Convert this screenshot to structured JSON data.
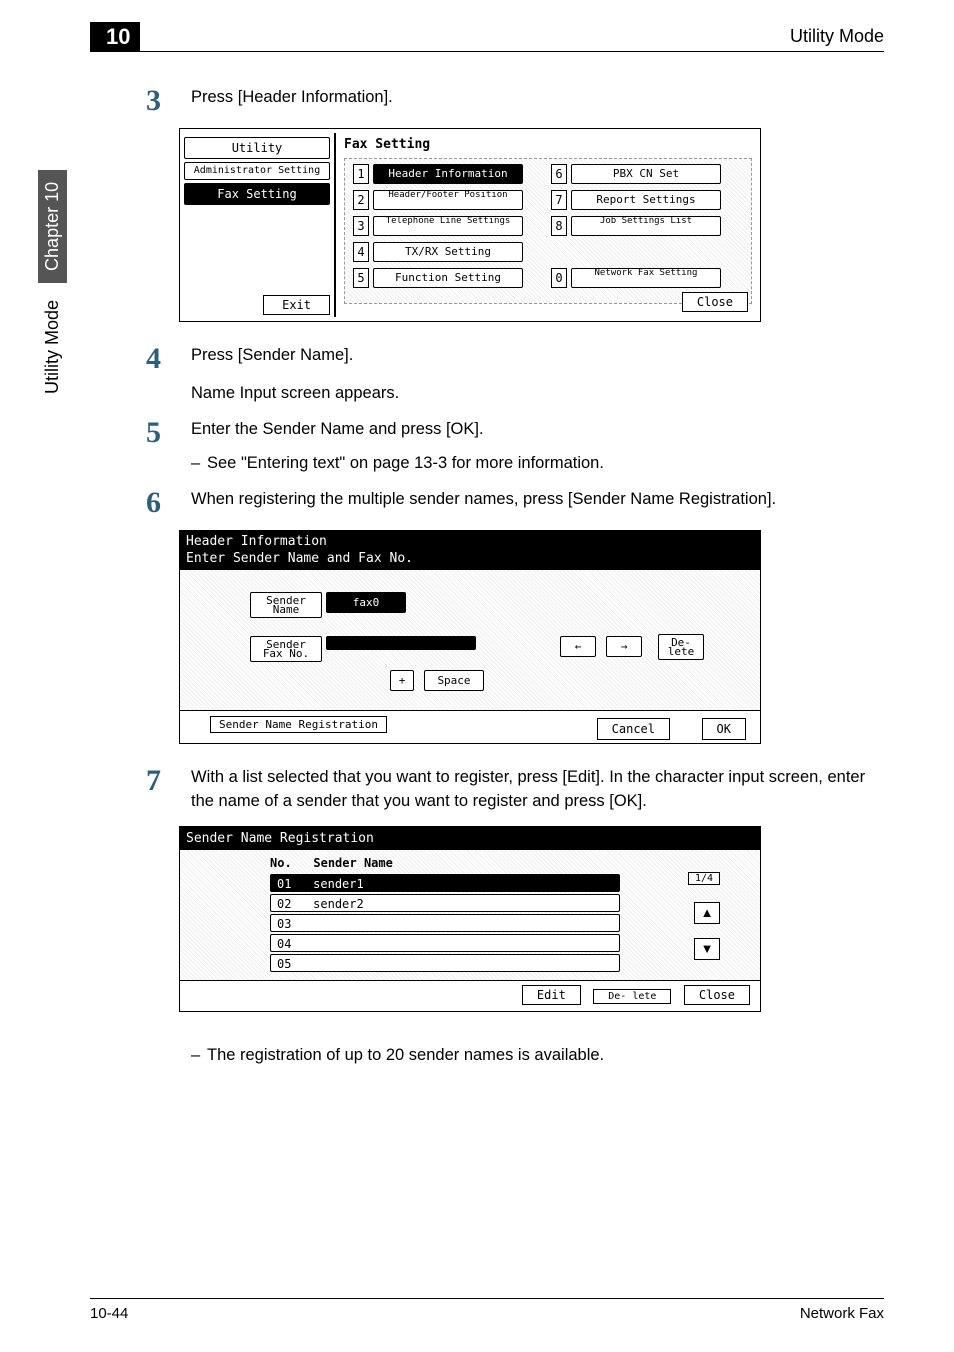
{
  "header": {
    "chapter_num": "10",
    "title": "Utility Mode"
  },
  "sidebar": {
    "plain": "Utility Mode",
    "box": "Chapter 10"
  },
  "steps": {
    "s3": {
      "num": "3",
      "text": "Press [Header Information]."
    },
    "s4": {
      "num": "4",
      "text": "Press [Sender Name].",
      "sub": "Name Input screen appears."
    },
    "s5": {
      "num": "5",
      "text": "Enter the Sender Name and press [OK].",
      "bullet": "See \"Entering text\" on page 13-3 for more information."
    },
    "s6": {
      "num": "6",
      "text": "When registering the multiple sender names, press [Sender Name Registration]."
    },
    "s7": {
      "num": "7",
      "text": "With a list selected that you want to register, press [Edit]. In the character input screen, enter the name of a sender that you want to register and press [OK].",
      "bullet": "The registration of up to 20 sender names is available."
    }
  },
  "fig1": {
    "left": {
      "utility": "Utility",
      "admin": "Administrator\nSetting",
      "fax": "Fax Setting",
      "exit": "Exit"
    },
    "title": "Fax Setting",
    "items": {
      "i1": "Header Information",
      "i2": "Header/Footer\nPosition",
      "i3": "Telephone Line\nSettings",
      "i4": "TX/RX Setting",
      "i5": "Function Setting",
      "i6": "PBX CN Set",
      "i7": "Report Settings",
      "i8": "Job Settings\nList",
      "i0": "Network Fax\nSetting"
    },
    "close": "Close"
  },
  "fig2": {
    "title1": "Header Information",
    "title2": "Enter Sender Name and Fax No.",
    "sender_name_label": "Sender\nName",
    "sender_name_val": "fax0",
    "sender_fax_label": "Sender\nFax No.",
    "arrow_l": "←",
    "arrow_r": "→",
    "delete": "De-\nlete",
    "plus": "+",
    "space": "Space",
    "reg": "Sender Name\nRegistration",
    "cancel": "Cancel",
    "ok": "OK"
  },
  "fig3": {
    "title": "Sender Name Registration",
    "col_no": "No.",
    "col_name": "Sender Name",
    "rows": {
      "r1n": "01",
      "r1v": "sender1",
      "r2n": "02",
      "r2v": "sender2",
      "r3n": "03",
      "r4n": "04",
      "r5n": "05"
    },
    "page": "1/4",
    "up": "▲",
    "down": "▼",
    "edit": "Edit",
    "delete": "De-\nlete",
    "close": "Close"
  },
  "footer": {
    "left": "10-44",
    "right": "Network Fax"
  }
}
